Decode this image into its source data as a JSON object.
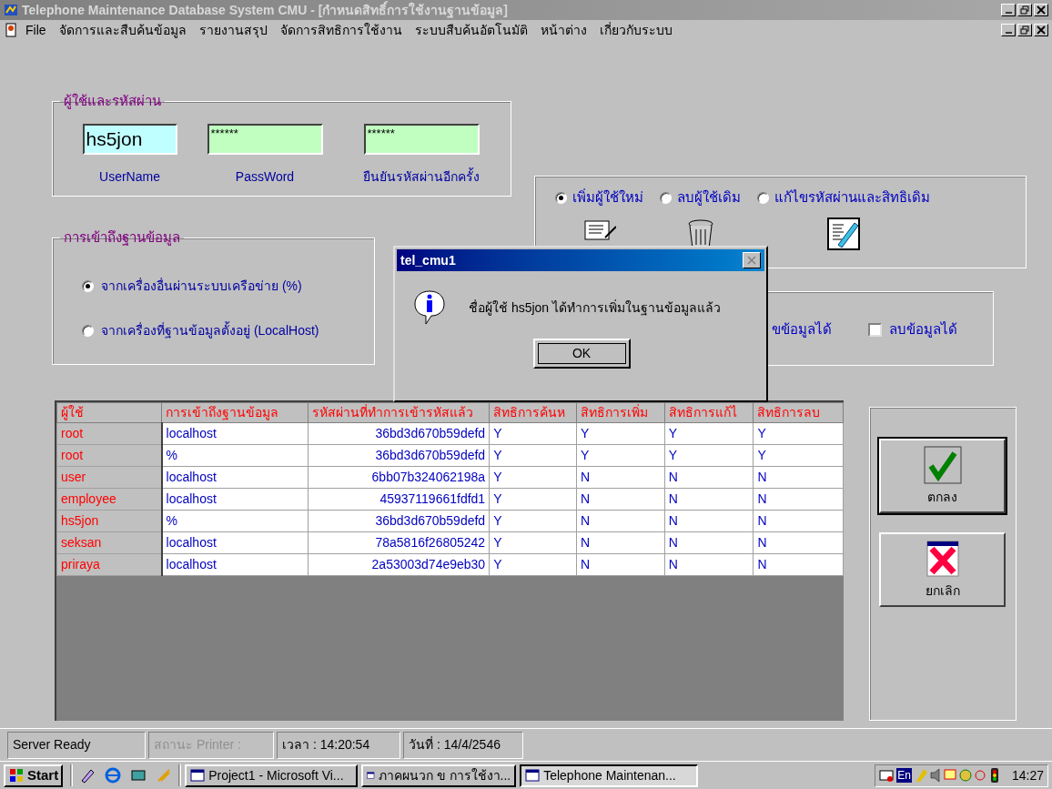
{
  "window": {
    "title": "Telephone Maintenance Database System CMU - [กำหนดสิทธิ์การใช้งานฐานข้อมูล]"
  },
  "menu": [
    "File",
    "จัดการและสืบค้นข้อมูล",
    "รายงานสรุป",
    "จัดการสิทธิการใช้งาน",
    "ระบบสืบค้นอัตโนมัติ",
    "หน้าต่าง",
    "เกี่ยวกับระบบ"
  ],
  "credentials": {
    "title": "ผู้ใช้และรหัสผ่าน",
    "fields": [
      {
        "label": "UserName",
        "value": "hs5jon",
        "kind": "text"
      },
      {
        "label": "PassWord",
        "value": "******",
        "kind": "password"
      },
      {
        "label": "ยืนยันรหัสผ่านอีกครั้ง",
        "value": "******",
        "kind": "password"
      }
    ]
  },
  "access": {
    "title": "การเข้าถึงฐานข้อมูล",
    "options": [
      {
        "label": "จากเครื่องอื่นผ่านระบบเครือข่าย (%)",
        "selected": true
      },
      {
        "label": "จากเครื่องที่ฐานข้อมูลตั้งอยู่ (LocalHost)",
        "selected": false
      }
    ]
  },
  "actions": {
    "options": [
      {
        "label": "เพิ่มผู้ใช้ใหม่",
        "selected": true
      },
      {
        "label": "ลบผู้ใช้เดิม",
        "selected": false
      },
      {
        "label": "แก้ไขรหัสผ่านและสิทธิเดิม",
        "selected": false
      }
    ]
  },
  "permissions": {
    "partial_label": "ขข้อมูลได้",
    "checkboxes": [
      {
        "label": "ลบข้อมูลได้",
        "checked": false
      }
    ]
  },
  "table": {
    "columns": [
      "ผู้ใช้",
      "การเข้าถึงฐานข้อมูล",
      "รหัสผ่านที่ทำการเข้ารหัสแล้ว",
      "สิทธิการค้นห",
      "สิทธิการเพิ่ม",
      "สิทธิการแก้ไ",
      "สิทธิการลบ"
    ],
    "rows": [
      [
        "root",
        "localhost",
        "36bd3d670b59defd",
        "Y",
        "Y",
        "Y",
        "Y"
      ],
      [
        "root",
        "%",
        "36bd3d670b59defd",
        "Y",
        "Y",
        "Y",
        "Y"
      ],
      [
        "user",
        "localhost",
        "6bb07b324062198a",
        "Y",
        "N",
        "N",
        "N"
      ],
      [
        "employee",
        "localhost",
        "45937119661fdfd1",
        "Y",
        "N",
        "N",
        "N"
      ],
      [
        "hs5jon",
        "%",
        "36bd3d670b59defd",
        "Y",
        "N",
        "N",
        "N"
      ],
      [
        "seksan",
        "localhost",
        "78a5816f26805242",
        "Y",
        "N",
        "N",
        "N"
      ],
      [
        "priraya",
        "localhost",
        "2a53003d74e9eb30",
        "Y",
        "N",
        "N",
        "N"
      ]
    ]
  },
  "buttons": [
    {
      "label": "ตกลง",
      "default": true
    },
    {
      "label": "ยกเลิก",
      "default": false
    }
  ],
  "dialog": {
    "title": "tel_cmu1",
    "message": "ชื่อผู้ใช้ hs5jon ได้ทำการเพิ่มในฐานข้อมูลแล้ว",
    "button": "OK"
  },
  "status_bar": [
    {
      "text": "Server Ready",
      "disabled": false
    },
    {
      "text": "สถานะ Printer :",
      "disabled": true
    },
    {
      "text": "เวลา : 14:20:54",
      "disabled": false
    },
    {
      "text": "วันที่ : 14/4/2546",
      "disabled": false
    }
  ],
  "taskbar": {
    "start": "Start",
    "tasks": [
      {
        "label": "Project1 - Microsoft Vi...",
        "selected": false
      },
      {
        "label": "ภาคผนวก ข การใช้งา...",
        "selected": false
      },
      {
        "label": "Telephone Maintenan...",
        "selected": true
      }
    ],
    "language": "En",
    "clock": "14:27"
  }
}
